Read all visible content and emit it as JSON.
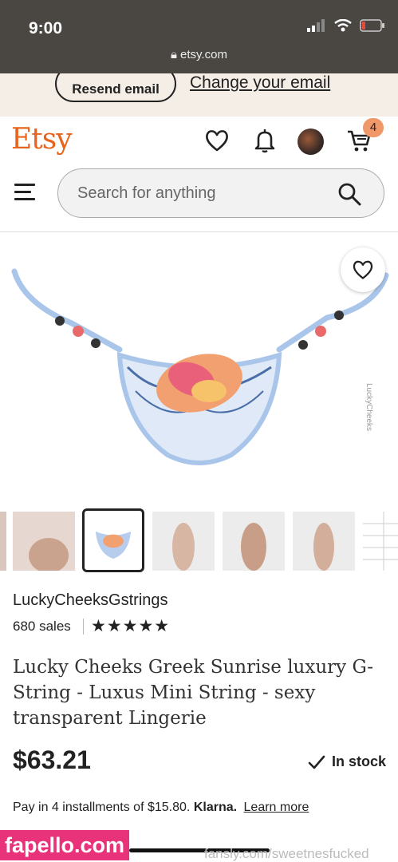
{
  "status_bar": {
    "time": "9:00",
    "url": "etsy.com"
  },
  "banner": {
    "resend_label": "Resend email",
    "change_label": "Change your email"
  },
  "header": {
    "logo": "Etsy",
    "cart_count": "4"
  },
  "search": {
    "placeholder": "Search for anything"
  },
  "product": {
    "shop_name": "LuckyCheeksGstrings",
    "sales": "680 sales",
    "rating_stars": "★★★★★",
    "title": "Lucky Cheeks Greek Sunrise luxury G-String - Luxus Mini String - sexy transparent Lingerie",
    "price": "$63.21",
    "stock": "In stock",
    "image_watermark": "LuckyCheeks"
  },
  "installments": {
    "text": "Pay in 4 installments of $15.80.",
    "provider": "Klarna.",
    "link": "Learn more"
  },
  "overlays": {
    "fapello": "fapello.com",
    "fansly": "fansly.com/sweetnesfucked"
  },
  "colors": {
    "brand": "#e8631c",
    "badge": "#f0986a",
    "banner": "#f5eee7",
    "status_bar": "#4a4743",
    "fapello": "#e8327a"
  }
}
